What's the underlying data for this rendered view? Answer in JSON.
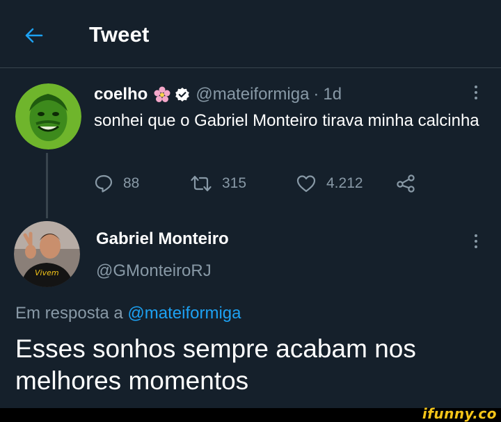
{
  "header": {
    "title": "Tweet",
    "back_icon": "arrow-left-icon"
  },
  "colors": {
    "background": "#15202b",
    "accent": "#1da1f2",
    "muted": "#8899a6",
    "divider": "#38444d"
  },
  "tweet": {
    "author_name": "coelho",
    "author_handle": "@mateiformiga",
    "separator": "·",
    "time": "1d",
    "text": "sonhei que o Gabriel Monteiro tirava minha calcinha",
    "stats": {
      "replies": "88",
      "retweets": "315",
      "likes": "4.212"
    }
  },
  "reply": {
    "author_name": "Gabriel Monteiro",
    "author_handle": "@GMonteiroRJ",
    "reply_prefix": "Em resposta a",
    "reply_handle": "@mateiformiga",
    "text": "Esses sonhos sempre acabam nos melhores momentos"
  },
  "watermark": {
    "text": "ifunny.co"
  }
}
